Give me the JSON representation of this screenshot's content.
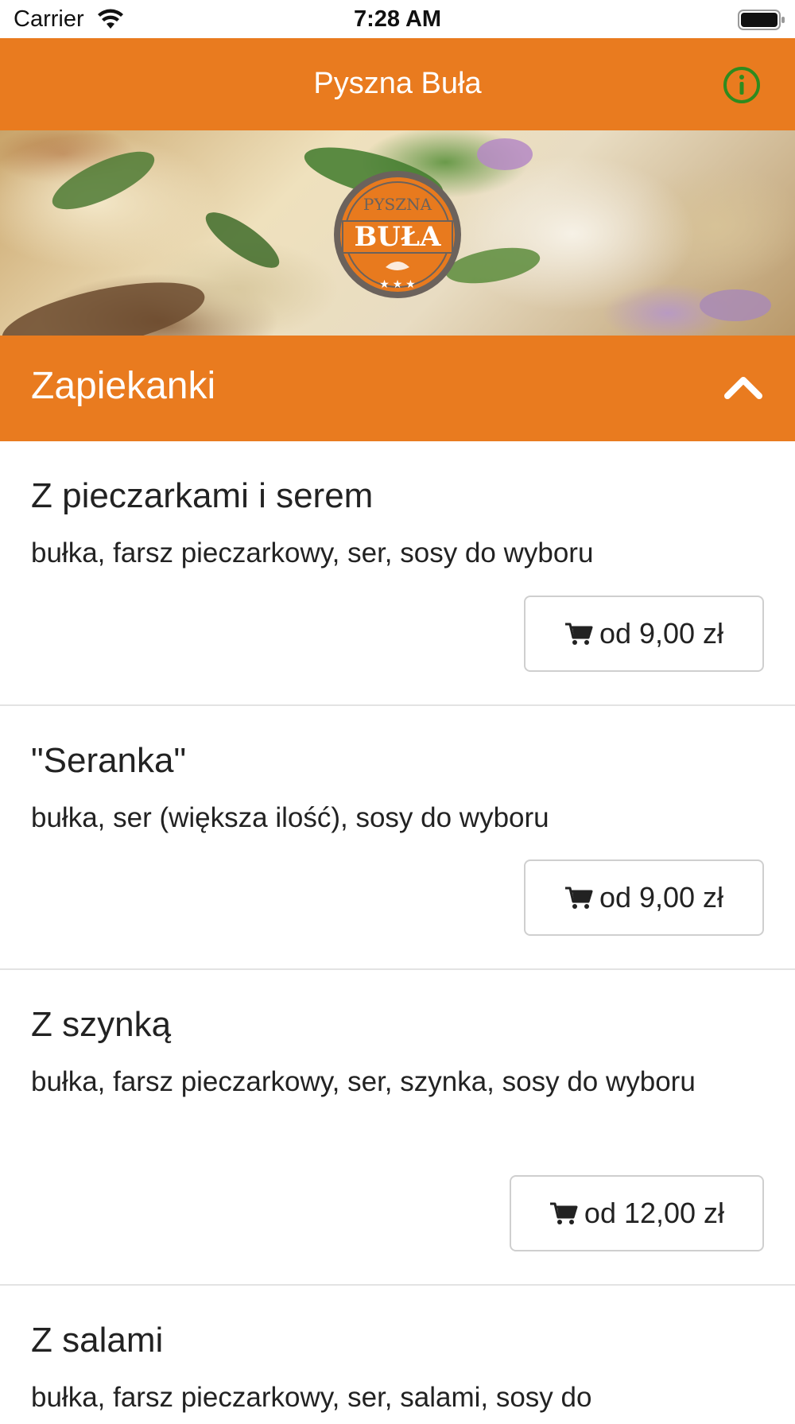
{
  "status_bar": {
    "carrier": "Carrier",
    "time": "7:28 AM"
  },
  "nav": {
    "title": "Pyszna Buła",
    "info_icon": "info-circle-icon"
  },
  "banner": {
    "logo_text_top": "PYSZNA",
    "logo_text_main": "BUŁA"
  },
  "category": {
    "title": "Zapiekanki",
    "expanded": true
  },
  "items": [
    {
      "name": "Z pieczarkami i serem",
      "description": "bułka, farsz pieczarkowy, ser, sosy do wyboru",
      "price_label": "od 9,00 zł"
    },
    {
      "name": "\"Seranka\"",
      "description": "bułka, ser (większa ilość), sosy do wyboru",
      "price_label": "od 9,00 zł"
    },
    {
      "name": "Z szynką",
      "description": "bułka, farsz pieczarkowy, ser, szynka, sosy do wyboru",
      "price_label": "od 12,00 zł"
    },
    {
      "name": "Z salami",
      "description": "bułka, farsz pieczarkowy, ser, salami, sosy do"
    }
  ],
  "colors": {
    "brand_orange": "#e97b1f",
    "info_green": "#2e8b1e"
  }
}
